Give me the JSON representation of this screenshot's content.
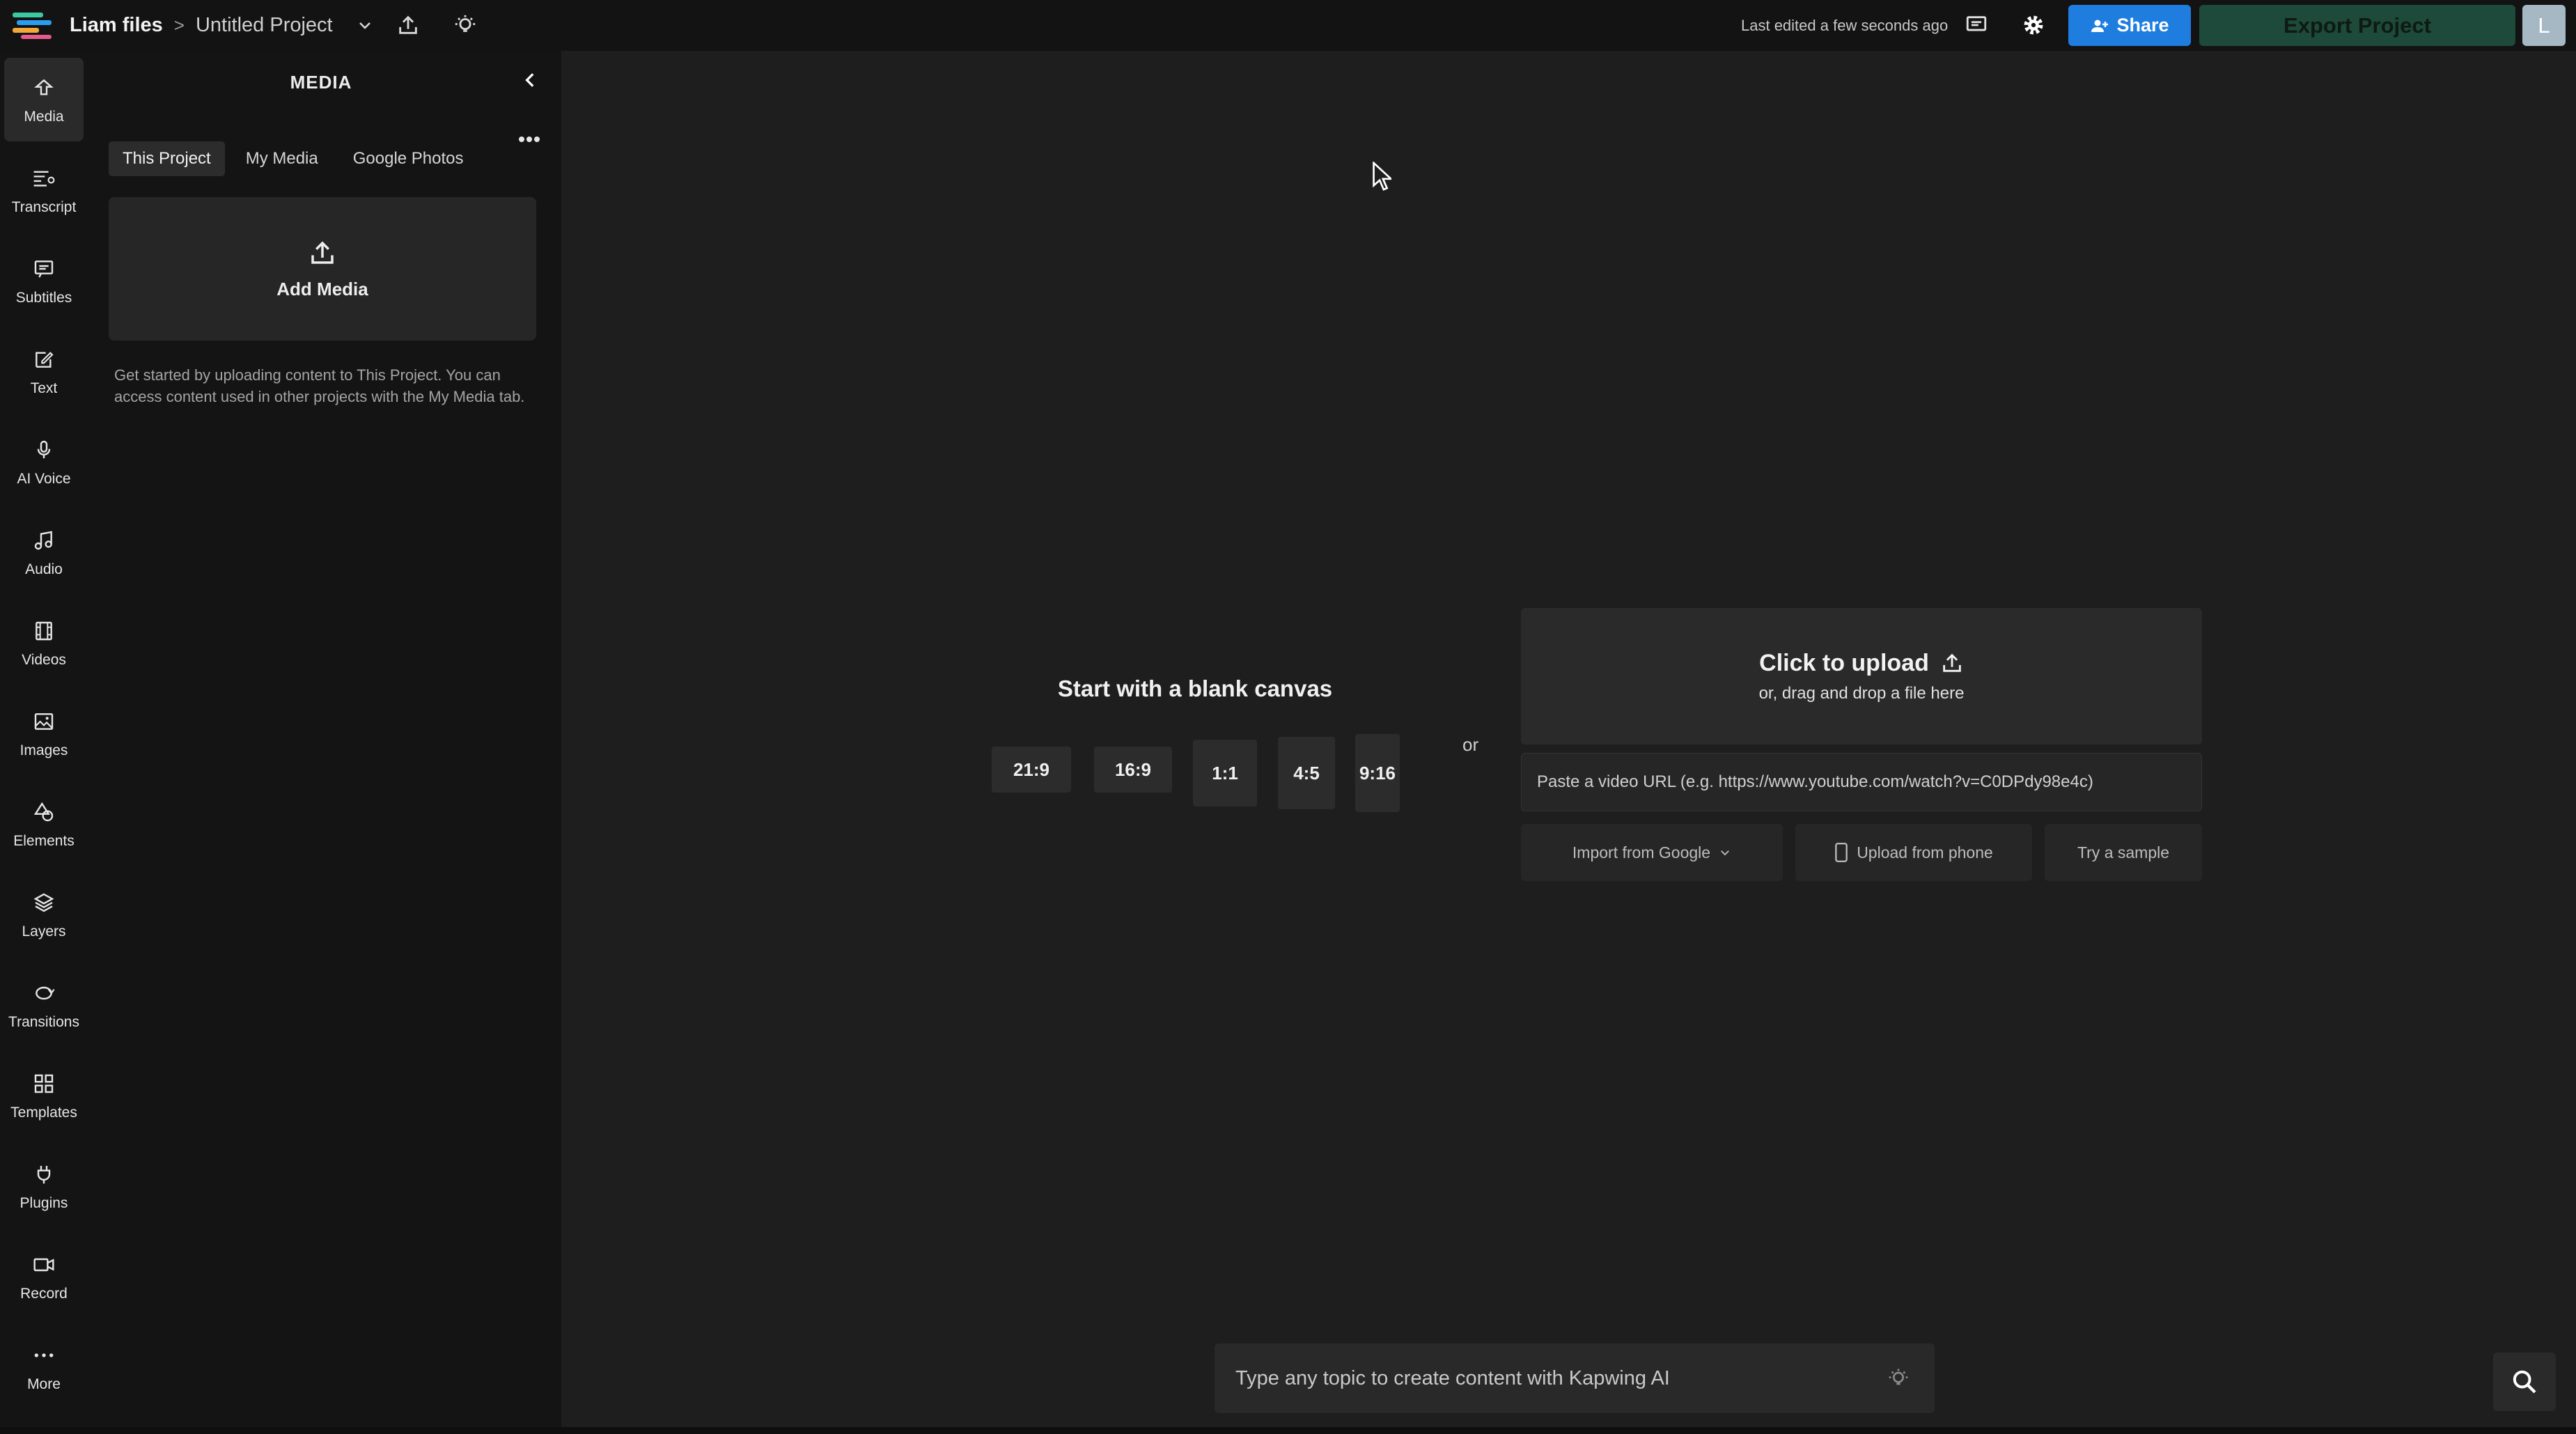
{
  "topbar": {
    "breadcrumb_root": "Liam files",
    "breadcrumb_separator": ">",
    "project_name": "Untitled Project",
    "last_edited": "Last edited a few seconds ago",
    "share_label": "Share",
    "export_label": "Export Project",
    "avatar_initial": "L"
  },
  "rail": {
    "items": [
      {
        "label": "Media",
        "icon": "media-icon",
        "active": true
      },
      {
        "label": "Transcript",
        "icon": "transcript-icon"
      },
      {
        "label": "Subtitles",
        "icon": "subtitles-icon"
      },
      {
        "label": "Text",
        "icon": "text-icon"
      },
      {
        "label": "AI Voice",
        "icon": "ai-voice-icon"
      },
      {
        "label": "Audio",
        "icon": "audio-icon"
      },
      {
        "label": "Videos",
        "icon": "videos-icon"
      },
      {
        "label": "Images",
        "icon": "images-icon"
      },
      {
        "label": "Elements",
        "icon": "elements-icon"
      },
      {
        "label": "Layers",
        "icon": "layers-icon"
      },
      {
        "label": "Transitions",
        "icon": "transitions-icon"
      },
      {
        "label": "Templates",
        "icon": "templates-icon"
      },
      {
        "label": "Plugins",
        "icon": "plugins-icon"
      },
      {
        "label": "Record",
        "icon": "record-icon"
      },
      {
        "label": "More",
        "icon": "more-icon"
      }
    ]
  },
  "panel": {
    "title": "MEDIA",
    "tabs": [
      "This Project",
      "My Media",
      "Google Photos"
    ],
    "active_tab": "This Project",
    "add_media_label": "Add Media",
    "help_text": "Get started by uploading content to This Project. You can access content used in other projects with the My Media tab."
  },
  "canvas": {
    "blank_title": "Start with a blank canvas",
    "ratios": [
      "21:9",
      "16:9",
      "1:1",
      "4:5",
      "9:16"
    ],
    "or_label": "or",
    "upload_main": "Click to upload",
    "upload_sub": "or, drag and drop a file here",
    "url_placeholder": "Paste a video URL (e.g. https://www.youtube.com/watch?v=C0DPdy98e4c)",
    "import_google": "Import from Google",
    "upload_phone": "Upload from phone",
    "try_sample": "Try a sample"
  },
  "ai_bar": {
    "placeholder": "Type any topic to create content with Kapwing AI"
  },
  "colors": {
    "accent_blue": "#1f7de0",
    "export_green": "#1d4a3a",
    "avatar_bg": "#a6b8c4",
    "background": "#1e1e1e"
  }
}
